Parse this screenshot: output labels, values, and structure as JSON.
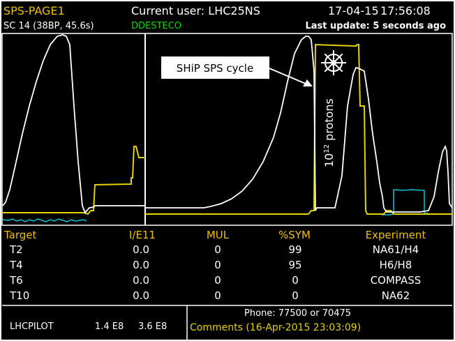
{
  "header": {
    "page_name": "SPS-PAGE1",
    "current_user": "Current user: LHC25NS",
    "date": "17-04-15",
    "time": "17:56:08",
    "cycle_info": "SC 14 (38BP, 45.6s)",
    "status": "DDESTECO",
    "last_update": "Last update: 5 seconds ago"
  },
  "annotation": {
    "callout_label": "SHiP SPS cycle",
    "protons_label_base": "10",
    "protons_label_exp": "12",
    "protons_label_unit": " protons",
    "icon": "ship-wheel-icon"
  },
  "table": {
    "columns": [
      "Target",
      "I/E11",
      "MUL",
      "%SYM",
      "Experiment"
    ],
    "rows": [
      [
        "T2",
        "0.0",
        "0",
        "99",
        "NA61/H4"
      ],
      [
        "T4",
        "0.0",
        "0",
        "95",
        "H6/H8"
      ],
      [
        "T6",
        "0.0",
        "0",
        "0",
        "COMPASS"
      ],
      [
        "T10",
        "0.0",
        "0",
        "0",
        "NA62"
      ]
    ]
  },
  "footer": {
    "pilot_name": "LHCPILOT",
    "pilot_value_1": "1.4 E8",
    "pilot_value_2": "3.6 E8",
    "phone": "Phone: 77500 or 70475",
    "comments": "Comments (16-Apr-2015 23:03:09)"
  },
  "colors": {
    "background": "#000000",
    "text": "#ffffff",
    "status_green": "#00e000",
    "yellow": "#e6d200",
    "cyan": "#00c8e0",
    "table_header": "#f0c000"
  }
}
